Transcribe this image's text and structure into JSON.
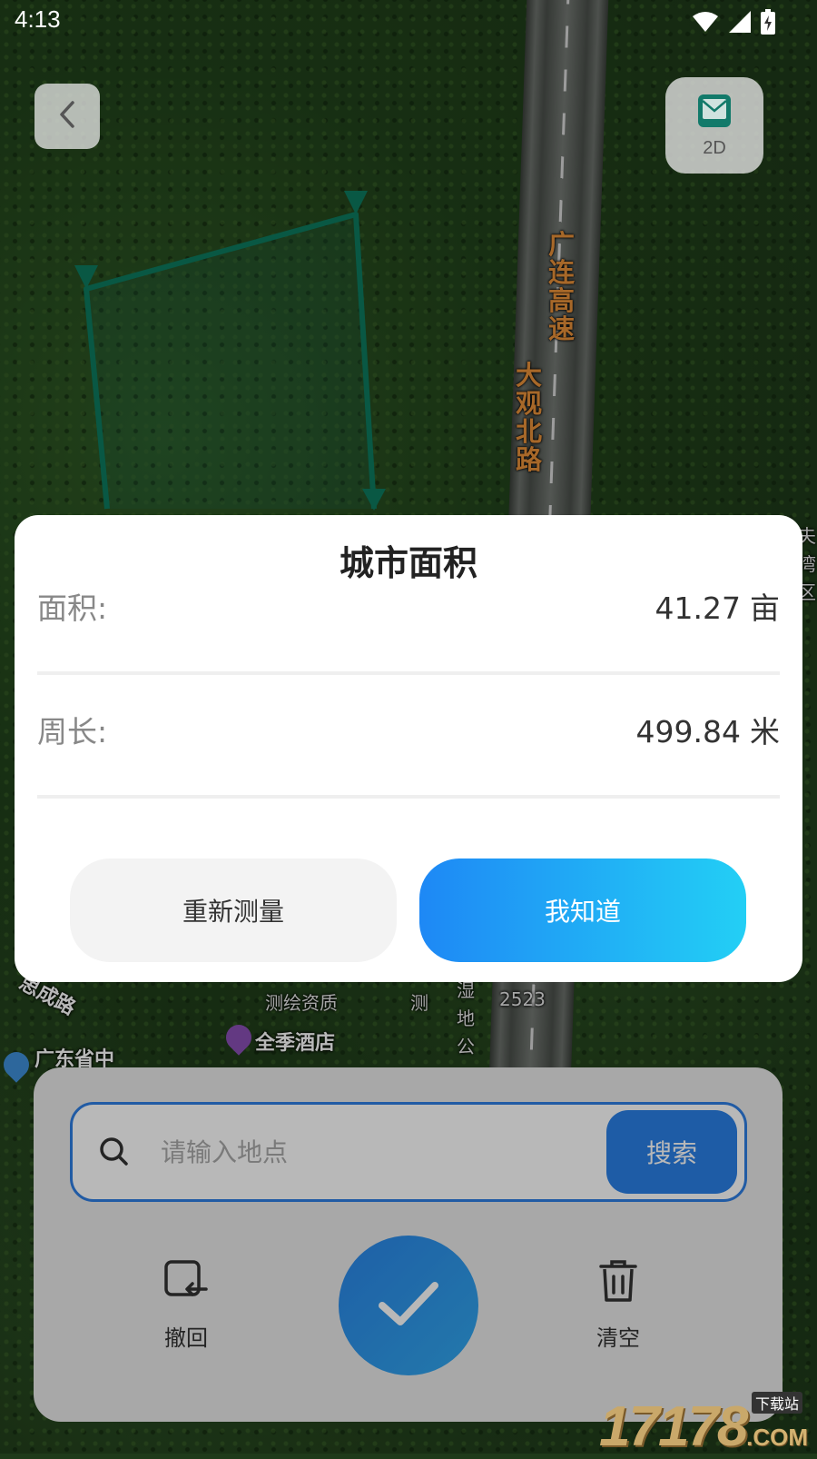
{
  "status_bar": {
    "time": "4:13"
  },
  "map": {
    "road_labels": [
      {
        "id": "guanglian",
        "text": "广连高速",
        "chars": [
          "广",
          "连",
          "高",
          "速"
        ]
      },
      {
        "id": "daguan",
        "text": "大观北路",
        "chars": [
          "大",
          "观",
          "北",
          "路"
        ]
      }
    ],
    "place_labels": {
      "chengdao": "思成路",
      "hotel": "全季酒店",
      "guangdong": "广东省中",
      "survey": "测绘资质",
      "survey_suffix": "测",
      "road_num": "2523",
      "vertical_road": "湿地公",
      "right_edge": "夫湾区"
    },
    "polygon_color": "#0d7a5f"
  },
  "top_controls": {
    "back_icon": "chevron-left-icon",
    "mode_icon": "map-layer-icon",
    "mode_label": "2D"
  },
  "dialog": {
    "title": "城市面积",
    "area": {
      "label": "面积:",
      "value": "41.27",
      "unit": "亩"
    },
    "perimeter": {
      "label": "周长:",
      "value": "499.84",
      "unit": "米"
    },
    "remeasure_label": "重新测量",
    "ok_label": "我知道",
    "ok_gradient": [
      "#1e88f5",
      "#23cff5"
    ]
  },
  "bottom_panel": {
    "search": {
      "placeholder": "请输入地点",
      "value": "",
      "button_label": "搜索"
    },
    "undo_label": "撤回",
    "clear_label": "清空",
    "confirm_icon": "checkmark-icon",
    "accent": "#2a80e6"
  },
  "watermark": {
    "digits": "17178",
    "suffix": ".COM",
    "tag": "下载站"
  }
}
